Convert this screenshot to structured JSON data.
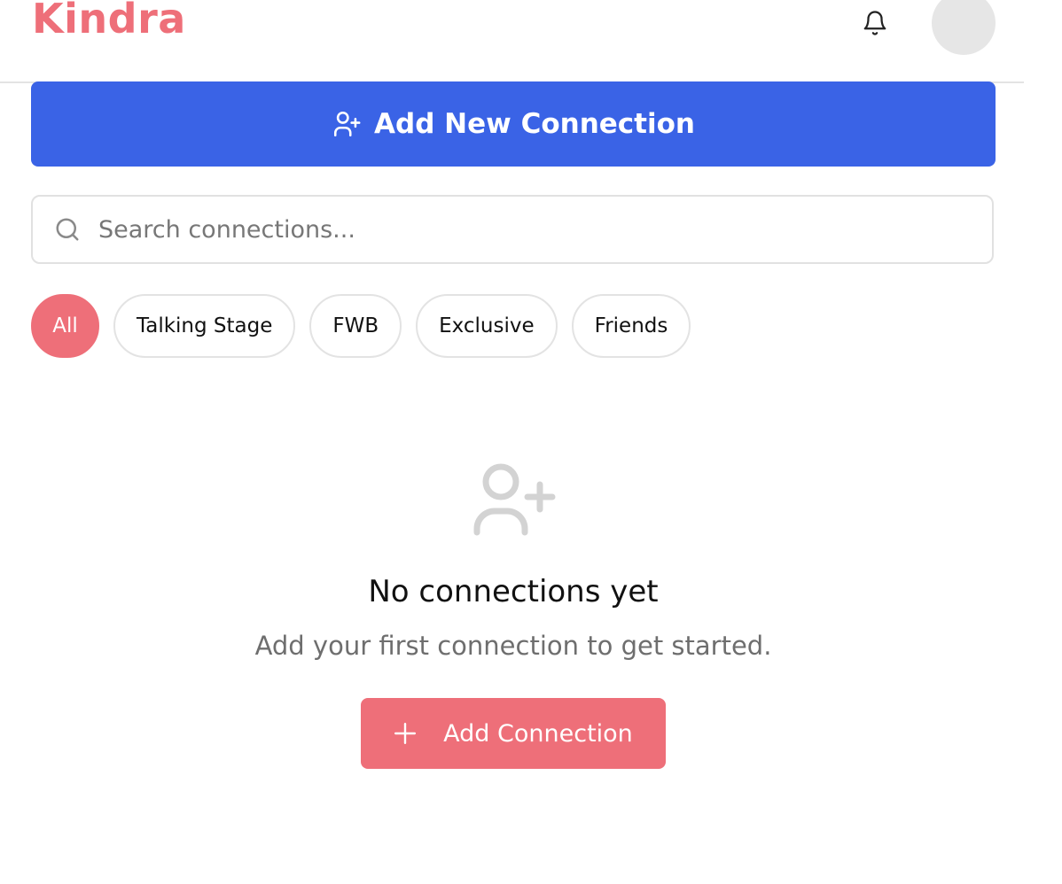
{
  "app": {
    "name": "Kindra",
    "brand_color": "#ee6f79",
    "primary_color": "#3a63e6"
  },
  "header": {
    "notification_icon": "bell-icon",
    "avatar": "avatar-placeholder"
  },
  "actions": {
    "add_new_label": "Add New Connection",
    "add_new_icon": "user-plus-icon"
  },
  "search": {
    "placeholder": "Search connections...",
    "value": "",
    "icon": "search-icon"
  },
  "filters": {
    "selected": "All",
    "items": [
      {
        "label": "All"
      },
      {
        "label": "Talking Stage"
      },
      {
        "label": "FWB"
      },
      {
        "label": "Exclusive"
      },
      {
        "label": "Friends"
      }
    ]
  },
  "empty_state": {
    "icon": "user-plus-icon",
    "title": "No connections yet",
    "subtitle": "Add your first connection to get started.",
    "button_label": "Add Connection",
    "button_icon": "plus-icon"
  }
}
